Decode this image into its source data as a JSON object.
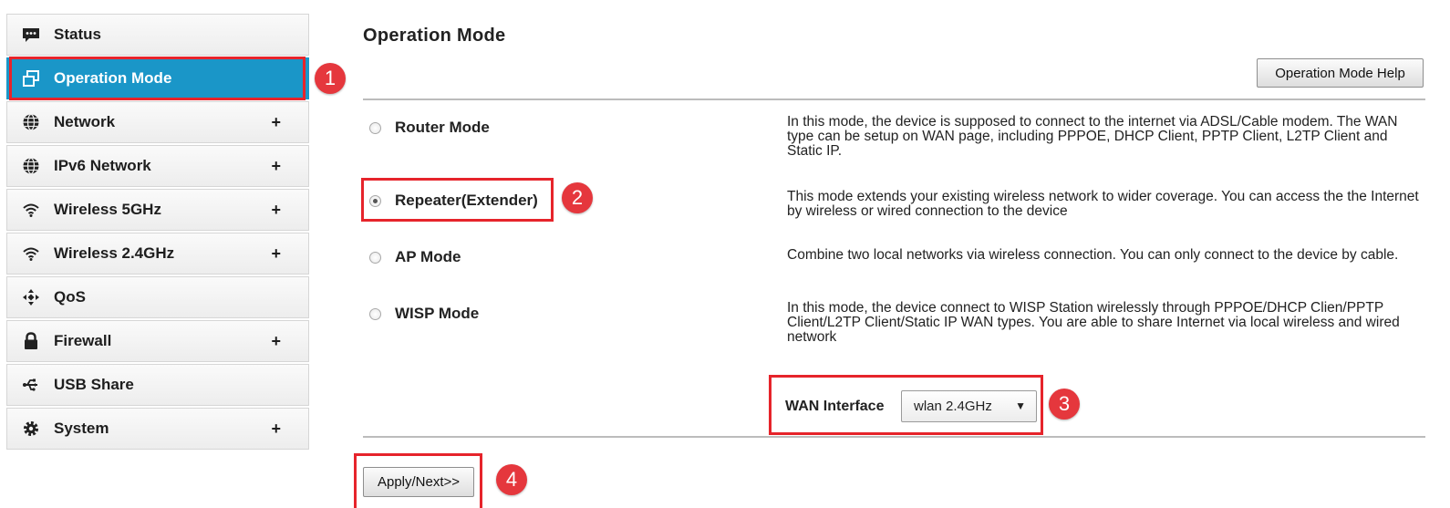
{
  "sidebar": {
    "items": [
      {
        "label": "Status",
        "icon": "chat-bubble-icon",
        "expand": ""
      },
      {
        "label": "Operation Mode",
        "icon": "windows-icon",
        "expand": ""
      },
      {
        "label": "Network",
        "icon": "globe-icon",
        "expand": "+"
      },
      {
        "label": "IPv6 Network",
        "icon": "globe-icon",
        "expand": "+"
      },
      {
        "label": "Wireless 5GHz",
        "icon": "wifi-icon",
        "expand": "+"
      },
      {
        "label": "Wireless 2.4GHz",
        "icon": "wifi-icon",
        "expand": "+"
      },
      {
        "label": "QoS",
        "icon": "qos-icon",
        "expand": ""
      },
      {
        "label": "Firewall",
        "icon": "lock-icon",
        "expand": "+"
      },
      {
        "label": "USB Share",
        "icon": "usb-icon",
        "expand": ""
      },
      {
        "label": "System",
        "icon": "gear-icon",
        "expand": "+"
      }
    ]
  },
  "main": {
    "title": "Operation Mode",
    "help_button": "Operation Mode Help",
    "modes": [
      {
        "label": "Router Mode",
        "checked": false,
        "description": "In this mode, the device is supposed to connect to the internet via ADSL/Cable modem. The WAN type can be setup on WAN page, including PPPOE, DHCP Client, PPTP Client, L2TP Client and Static IP."
      },
      {
        "label": "Repeater(Extender)",
        "checked": true,
        "description": "This mode extends your existing wireless network to wider coverage. You can access the the Internet by wireless or wired connection to the device"
      },
      {
        "label": "AP Mode",
        "checked": false,
        "description": "Combine two local networks via wireless connection. You can only connect to the device by cable."
      },
      {
        "label": "WISP Mode",
        "checked": false,
        "description": "In this mode, the device connect to WISP Station wirelessly through PPPOE/DHCP Clien/PPTP Client/L2TP Client/Static IP WAN types. You are able to share Internet via local wireless and wired network"
      }
    ],
    "wan_interface_label": "WAN Interface",
    "wan_interface_value": "wlan 2.4GHz",
    "apply_button": "Apply/Next>>"
  },
  "annotations": [
    "1",
    "2",
    "3",
    "4"
  ],
  "colors": {
    "accent": "#1a96c8",
    "highlight": "#e6242b",
    "badge": "#e5373d"
  }
}
